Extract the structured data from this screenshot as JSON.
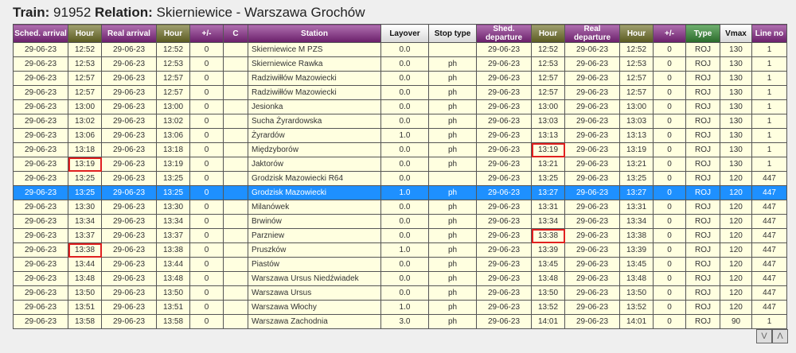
{
  "title": {
    "train_label": "Train:",
    "train_no": "91952",
    "relation_label": "Relation:",
    "relation": "Skierniewice - Warszawa Grochów"
  },
  "headers": [
    "Sched. arrival",
    "Hour",
    "Real arrival",
    "Hour",
    "+/-",
    "C",
    "Station",
    "Layover",
    "Stop type",
    "Shed. departure",
    "Hour",
    "Real departure",
    "Hour",
    "+/-",
    "Type",
    "Vmax",
    "Line no"
  ],
  "selected_row": 10,
  "highlighted": [
    [
      7,
      10
    ],
    [
      8,
      1
    ],
    [
      13,
      10
    ],
    [
      14,
      1
    ]
  ],
  "rows": [
    [
      "29-06-23",
      "12:52",
      "29-06-23",
      "12:52",
      "0",
      "",
      "Skierniewice M PZS",
      "0.0",
      "",
      "29-06-23",
      "12:52",
      "29-06-23",
      "12:52",
      "0",
      "ROJ",
      "130",
      "1"
    ],
    [
      "29-06-23",
      "12:53",
      "29-06-23",
      "12:53",
      "0",
      "",
      "Skierniewice Rawka",
      "0.0",
      "ph",
      "29-06-23",
      "12:53",
      "29-06-23",
      "12:53",
      "0",
      "ROJ",
      "130",
      "1"
    ],
    [
      "29-06-23",
      "12:57",
      "29-06-23",
      "12:57",
      "0",
      "",
      "Radziwiłłów Mazowiecki",
      "0.0",
      "ph",
      "29-06-23",
      "12:57",
      "29-06-23",
      "12:57",
      "0",
      "ROJ",
      "130",
      "1"
    ],
    [
      "29-06-23",
      "12:57",
      "29-06-23",
      "12:57",
      "0",
      "",
      "Radziwiłłów Mazowiecki",
      "0.0",
      "ph",
      "29-06-23",
      "12:57",
      "29-06-23",
      "12:57",
      "0",
      "ROJ",
      "130",
      "1"
    ],
    [
      "29-06-23",
      "13:00",
      "29-06-23",
      "13:00",
      "0",
      "",
      "Jesionka",
      "0.0",
      "ph",
      "29-06-23",
      "13:00",
      "29-06-23",
      "13:00",
      "0",
      "ROJ",
      "130",
      "1"
    ],
    [
      "29-06-23",
      "13:02",
      "29-06-23",
      "13:02",
      "0",
      "",
      "Sucha Żyrardowska",
      "0.0",
      "ph",
      "29-06-23",
      "13:03",
      "29-06-23",
      "13:03",
      "0",
      "ROJ",
      "130",
      "1"
    ],
    [
      "29-06-23",
      "13:06",
      "29-06-23",
      "13:06",
      "0",
      "",
      "Żyrardów",
      "1.0",
      "ph",
      "29-06-23",
      "13:13",
      "29-06-23",
      "13:13",
      "0",
      "ROJ",
      "130",
      "1"
    ],
    [
      "29-06-23",
      "13:18",
      "29-06-23",
      "13:18",
      "0",
      "",
      "Międzyborów",
      "0.0",
      "ph",
      "29-06-23",
      "13:19",
      "29-06-23",
      "13:19",
      "0",
      "ROJ",
      "130",
      "1"
    ],
    [
      "29-06-23",
      "13:19",
      "29-06-23",
      "13:19",
      "0",
      "",
      "Jaktorów",
      "0.0",
      "ph",
      "29-06-23",
      "13:21",
      "29-06-23",
      "13:21",
      "0",
      "ROJ",
      "130",
      "1"
    ],
    [
      "29-06-23",
      "13:25",
      "29-06-23",
      "13:25",
      "0",
      "",
      "Grodzisk Mazowiecki R64",
      "0.0",
      "",
      "29-06-23",
      "13:25",
      "29-06-23",
      "13:25",
      "0",
      "ROJ",
      "120",
      "447"
    ],
    [
      "29-06-23",
      "13:25",
      "29-06-23",
      "13:25",
      "0",
      "",
      "Grodzisk Mazowiecki",
      "1.0",
      "ph",
      "29-06-23",
      "13:27",
      "29-06-23",
      "13:27",
      "0",
      "ROJ",
      "120",
      "447"
    ],
    [
      "29-06-23",
      "13:30",
      "29-06-23",
      "13:30",
      "0",
      "",
      "Milanówek",
      "0.0",
      "ph",
      "29-06-23",
      "13:31",
      "29-06-23",
      "13:31",
      "0",
      "ROJ",
      "120",
      "447"
    ],
    [
      "29-06-23",
      "13:34",
      "29-06-23",
      "13:34",
      "0",
      "",
      "Brwinów",
      "0.0",
      "ph",
      "29-06-23",
      "13:34",
      "29-06-23",
      "13:34",
      "0",
      "ROJ",
      "120",
      "447"
    ],
    [
      "29-06-23",
      "13:37",
      "29-06-23",
      "13:37",
      "0",
      "",
      "Parzniew",
      "0.0",
      "ph",
      "29-06-23",
      "13:38",
      "29-06-23",
      "13:38",
      "0",
      "ROJ",
      "120",
      "447"
    ],
    [
      "29-06-23",
      "13:38",
      "29-06-23",
      "13:38",
      "0",
      "",
      "Pruszków",
      "1.0",
      "ph",
      "29-06-23",
      "13:39",
      "29-06-23",
      "13:39",
      "0",
      "ROJ",
      "120",
      "447"
    ],
    [
      "29-06-23",
      "13:44",
      "29-06-23",
      "13:44",
      "0",
      "",
      "Piastów",
      "0.0",
      "ph",
      "29-06-23",
      "13:45",
      "29-06-23",
      "13:45",
      "0",
      "ROJ",
      "120",
      "447"
    ],
    [
      "29-06-23",
      "13:48",
      "29-06-23",
      "13:48",
      "0",
      "",
      "Warszawa Ursus Niedźwiadek",
      "0.0",
      "ph",
      "29-06-23",
      "13:48",
      "29-06-23",
      "13:48",
      "0",
      "ROJ",
      "120",
      "447"
    ],
    [
      "29-06-23",
      "13:50",
      "29-06-23",
      "13:50",
      "0",
      "",
      "Warszawa Ursus",
      "0.0",
      "ph",
      "29-06-23",
      "13:50",
      "29-06-23",
      "13:50",
      "0",
      "ROJ",
      "120",
      "447"
    ],
    [
      "29-06-23",
      "13:51",
      "29-06-23",
      "13:51",
      "0",
      "",
      "Warszawa Włochy",
      "1.0",
      "ph",
      "29-06-23",
      "13:52",
      "29-06-23",
      "13:52",
      "0",
      "ROJ",
      "120",
      "447"
    ],
    [
      "29-06-23",
      "13:58",
      "29-06-23",
      "13:58",
      "0",
      "",
      "Warszawa Zachodnia",
      "3.0",
      "ph",
      "29-06-23",
      "14:01",
      "29-06-23",
      "14:01",
      "0",
      "ROJ",
      "90",
      "1"
    ]
  ],
  "nav": {
    "down": "V",
    "up": "Λ"
  }
}
